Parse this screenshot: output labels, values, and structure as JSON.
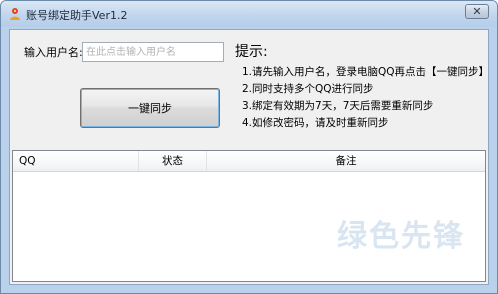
{
  "window": {
    "title": "账号绑定助手Ver1.2",
    "close_glyph": "✕",
    "icon": "app-icon"
  },
  "form": {
    "username_label": "输入用户名:",
    "username_value": "",
    "username_placeholder": "在此点击输入用户名",
    "sync_button_label": "一键同步"
  },
  "tips": {
    "title": "提示:",
    "items": [
      "1.请先输入用户名，登录电脑QQ再点击【一键同步】",
      "2.同时支持多个QQ进行同步",
      "3.绑定有效期为7天，7天后需要重新同步",
      "4.如修改密码，请及时重新同步"
    ]
  },
  "table": {
    "columns": [
      "QQ",
      "状态",
      "备注"
    ],
    "rows": []
  },
  "watermark": "绿色先锋",
  "colors": {
    "title_bar": "#c3d7ee",
    "client_bg": "#f0f0f0",
    "button_focus": "#7bb8e8"
  }
}
